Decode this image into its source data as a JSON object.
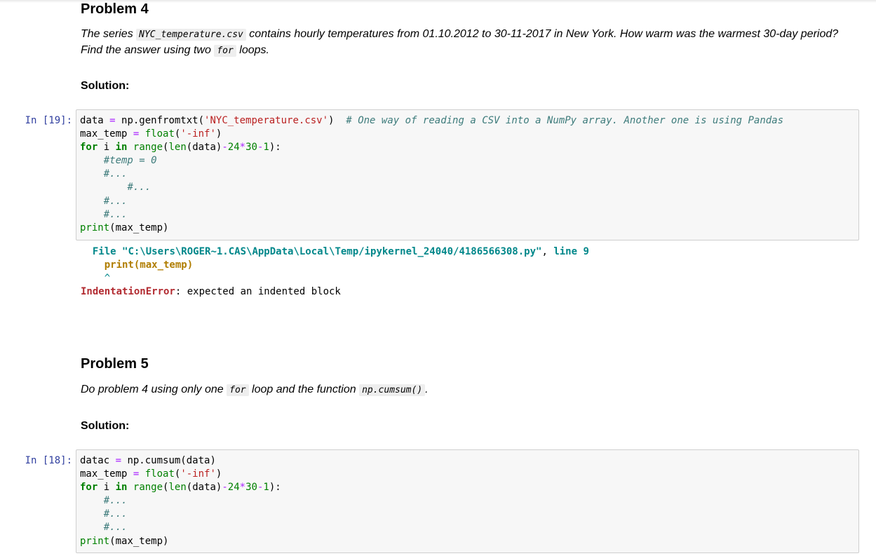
{
  "problem4": {
    "title": "Problem 4",
    "line1_a": "The series ",
    "line1_code": "NYC_temperature.csv",
    "line1_b": " contains hourly temperatures from 01.10.2012 to 30-11-2017 in New York. How warm was the warmest 30-day period?",
    "line2_a": "Find the answer using two ",
    "line2_code": "for",
    "line2_b": " loops.",
    "solution": "Solution:"
  },
  "cell19": {
    "prompt": "In [19]:",
    "code": {
      "v_data": "data",
      "eq": " = ",
      "np_call": "np.genfromtxt(",
      "str_file": "'NYC_temperature.csv'",
      "close": ")",
      "comment": "# One way of reading a CSV into a NumPy array. Another one is using Pandas",
      "v_max": "max_temp",
      "float": "float",
      "str_inf": "'-inf'",
      "kw_for": "for",
      "var_i": " i ",
      "kw_in": "in",
      "range": "range",
      "len": "len",
      "len_arg": "(data)",
      "minus": "-",
      "n24": "24",
      "times": "*",
      "n30": "30",
      "n1": "1",
      "tail": "):",
      "c_temp": "#temp = 0",
      "c_dots": "#...",
      "print": "print",
      "print_arg": "(max_temp)"
    },
    "output": {
      "file_label": "File",
      "file_path": "\"C:\\Users\\ROGER~1.CAS\\AppData\\Local\\Temp/ipykernel_24040/4186566308.py\"",
      "comma": ", ",
      "line_label": "line",
      "line_num": "9",
      "code_line": "print(max_temp)",
      "caret": "^",
      "error_name": "IndentationError",
      "error_msg": ": expected an indented block"
    }
  },
  "problem5": {
    "title": "Problem 5",
    "line1_a": "Do problem 4 using only one ",
    "line1_code1": "for",
    "line1_b": " loop and the function ",
    "line1_code2": "np.cumsum()",
    "line1_c": ".",
    "solution": "Solution:"
  },
  "cell18": {
    "prompt": "In [18]:",
    "code": {
      "v_datac": "datac",
      "eq": " = ",
      "np_call": "np.cumsum(data)",
      "v_max": "max_temp",
      "float": "float",
      "str_inf": "'-inf'",
      "kw_for": "for",
      "var_i": " i ",
      "kw_in": "in",
      "range": "range",
      "len": "len",
      "len_arg": "(data)",
      "minus": "-",
      "n24": "24",
      "times": "*",
      "n30": "30",
      "n1": "1",
      "tail": "):",
      "c_dots": "#...",
      "print": "print",
      "print_arg": "(max_temp)"
    }
  }
}
